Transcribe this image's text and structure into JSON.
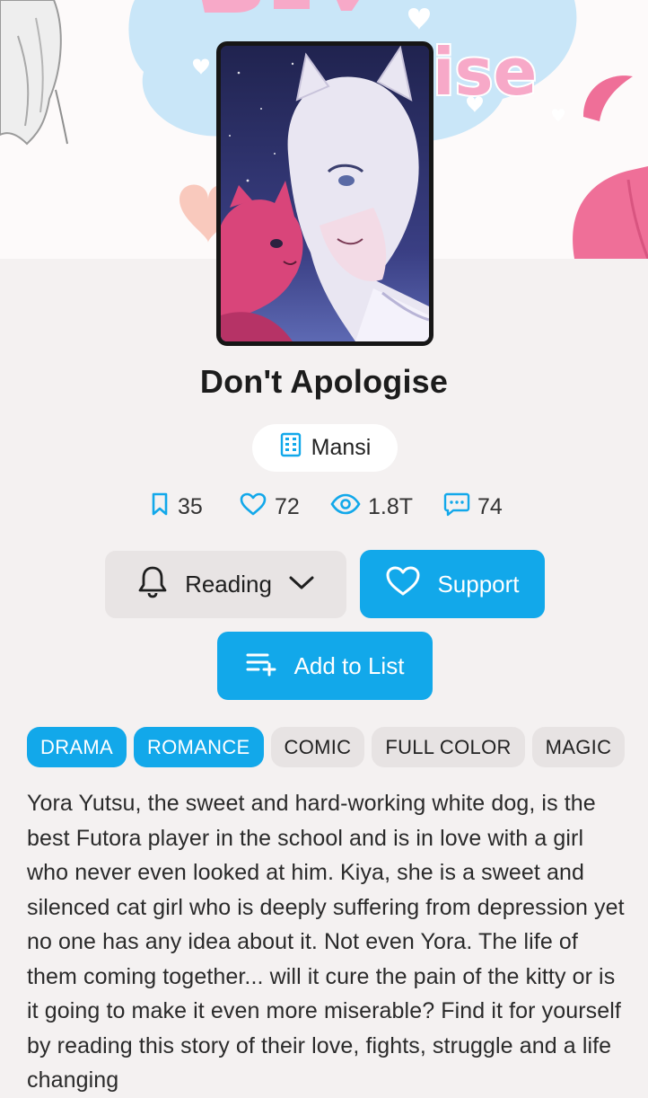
{
  "story": {
    "title": "Don't Apologise",
    "author": "Mansi"
  },
  "stats": {
    "bookmarks": "35",
    "likes": "72",
    "views": "1.8T",
    "comments": "74"
  },
  "actions": {
    "reading_label": "Reading",
    "support_label": "Support",
    "add_to_list_label": "Add to List"
  },
  "tags": [
    {
      "label": "DRAMA",
      "style": "primary"
    },
    {
      "label": "ROMANCE",
      "style": "primary"
    },
    {
      "label": "COMIC",
      "style": "secondary"
    },
    {
      "label": "FULL COLOR",
      "style": "secondary"
    },
    {
      "label": "MAGIC",
      "style": "secondary"
    }
  ],
  "description": "Yora Yutsu, the sweet and hard-working white dog, is the best Futora player in the school and is in love with a girl who never even looked at him. Kiya, she is a sweet and silenced cat girl who is deeply suffering from depression yet no one has any idea about it. Not even Yora. The life of them coming together... will it cure the pain of the kitty or is it going to make it even more miserable? Find it for yourself by reading this story of their love, fights, struggle and a life changing",
  "colors": {
    "accent": "#12a8ea",
    "page_bg": "#f4f1f1",
    "button_neutral": "#e8e4e4",
    "title_text": "#1c1c1c"
  },
  "icons": {
    "author": "building-icon",
    "bookmarks": "bookmark-icon",
    "likes": "heart-icon",
    "views": "eye-icon",
    "comments": "comment-icon",
    "reading": "bell-icon",
    "reading_dropdown": "chevron-down-icon",
    "support": "heart-icon",
    "add_to_list": "playlist-add-icon"
  }
}
